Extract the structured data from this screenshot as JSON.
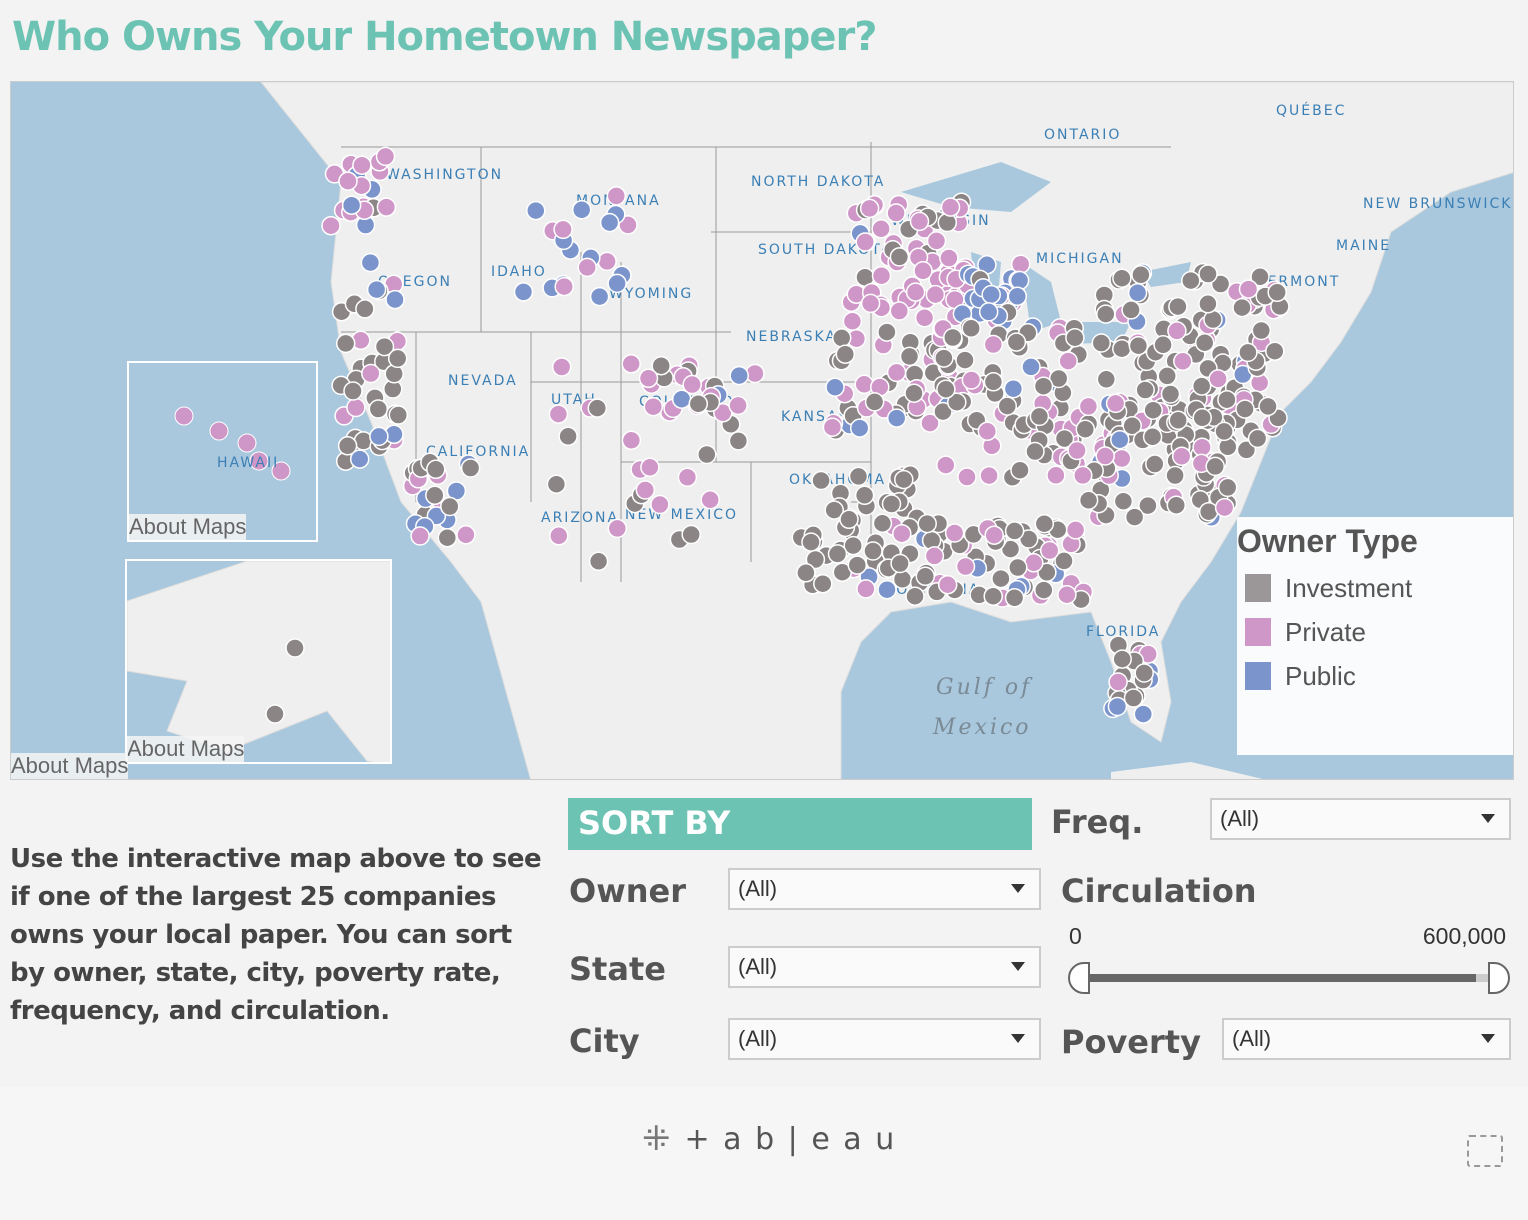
{
  "title": "Who Owns Your Hometown Newspaper?",
  "map": {
    "labels": [
      "QUÉBEC",
      "ONTARIO",
      "NEW BRUNSWICK",
      "MAINE",
      "VERMONT",
      "WASHINGTON",
      "MONTANA",
      "NORTH DAKOTA",
      "SOUTH DAKOTA",
      "OREGON",
      "IDAHO",
      "WYOMING",
      "NEBRASKA",
      "NEVADA",
      "UTAH",
      "COLORADO",
      "KANSAS",
      "CALIFORNIA",
      "ARIZONA",
      "NEW MEXICO",
      "OKLAHOMA",
      "MICHIGAN",
      "WISCONSIN",
      "LOUISIANA",
      "FLORIDA",
      "HAWAII"
    ],
    "gulf": [
      "Gulf of",
      "Mexico"
    ],
    "about_maps": "About Maps",
    "colors": {
      "water": "#a9c8dd",
      "land": "#efefef"
    }
  },
  "legend": {
    "title": "Owner Type",
    "items": [
      {
        "label": "Investment",
        "color": "#9b9798"
      },
      {
        "label": "Private",
        "color": "#cf97c7"
      },
      {
        "label": "Public",
        "color": "#7b95cc"
      }
    ]
  },
  "description": "Use the interactive map above to see if one of the largest 25 companies owns your local paper. You can sort by owner, state, city, poverty rate, frequency, and circulation.",
  "filters": {
    "sort_by": "SORT BY",
    "owner": {
      "label": "Owner",
      "value": "(All)"
    },
    "state": {
      "label": "State",
      "value": "(All)"
    },
    "city": {
      "label": "City",
      "value": "(All)"
    },
    "freq": {
      "label": "Freq.",
      "value": "(All)"
    },
    "poverty": {
      "label": "Poverty",
      "value": "(All)"
    },
    "circulation": {
      "label": "Circulation",
      "min": "0",
      "max": "600,000",
      "range_fraction": [
        0,
        0.97
      ]
    }
  },
  "footer": {
    "logo": "+ a b | e a u"
  }
}
